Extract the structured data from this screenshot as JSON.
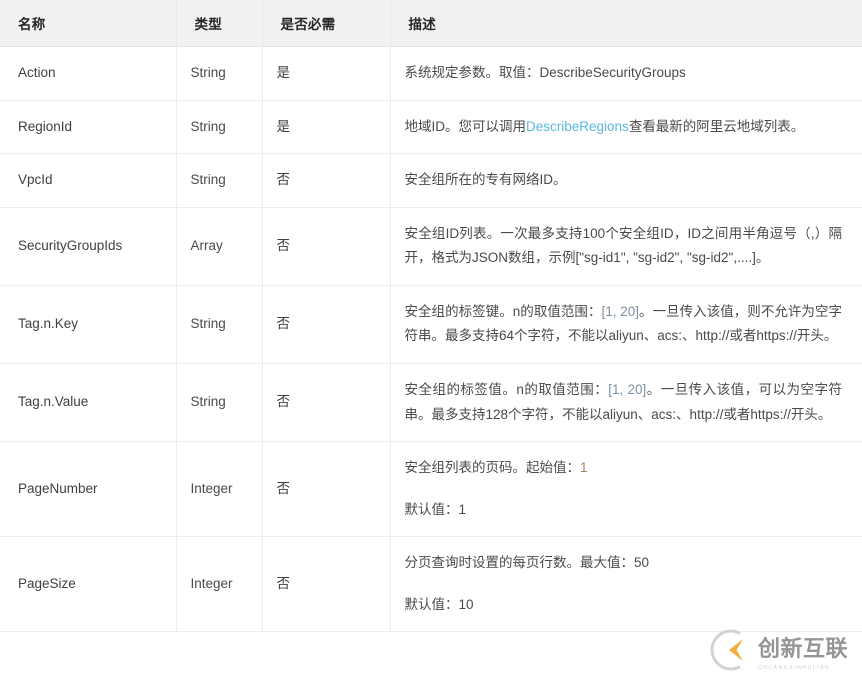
{
  "table": {
    "columns": [
      {
        "key": "name",
        "label": "名称"
      },
      {
        "key": "type",
        "label": "类型"
      },
      {
        "key": "required",
        "label": "是否必需"
      },
      {
        "key": "description",
        "label": "描述"
      }
    ],
    "rows": [
      {
        "name": "Action",
        "type": "String",
        "required": "是",
        "description_lines": [
          "系统规定参数。取值：DescribeSecurityGroups"
        ],
        "description_plain": "系统规定参数。取值：DescribeSecurityGroups"
      },
      {
        "name": "RegionId",
        "type": "String",
        "required": "是",
        "description_lines": [
          "地域ID。您可以调用DescribeRegions查看最新的阿里云地域列表。"
        ],
        "description_plain": "地域ID。您可以调用DescribeRegions查看最新的阿里云地域列表。",
        "description_link": {
          "text": "DescribeRegions",
          "before": "地域ID。您可以调用",
          "after": "查看最新的阿里云地域列表。"
        }
      },
      {
        "name": "VpcId",
        "type": "String",
        "required": "否",
        "description_lines": [
          "安全组所在的专有网络ID。"
        ],
        "description_plain": "安全组所在的专有网络ID。"
      },
      {
        "name": "SecurityGroupIds",
        "type": "Array",
        "required": "否",
        "description_lines": [
          "安全组ID列表。一次最多支持100个安全组ID，ID之间用半角逗号（,）隔开，格式为JSON数组，示例[\"sg-id1\", \"sg-id2\", \"sg-id2\",....]。"
        ],
        "description_plain": "安全组ID列表。一次最多支持100个安全组ID，ID之间用半角逗号（,）隔开，格式为JSON数组，示例[\"sg-id1\", \"sg-id2\", \"sg-id2\",....]。"
      },
      {
        "name": "Tag.n.Key",
        "type": "String",
        "required": "否",
        "description_lines": [
          "安全组的标签键。n的取值范围：[1, 20]。一旦传入该值，则不允许为空字符串。最多支持64个字符，不能以aliyun、acs:、http://或者https://开头。"
        ],
        "description_plain": "安全组的标签键。n的取值范围：[1, 20]。一旦传入该值，则不允许为空字符串。最多支持64个字符，不能以aliyun、acs:、http://或者https://开头。",
        "description_parts": {
          "before": "安全组的标签键。n的取值范围：",
          "range": "[1, 20]",
          "after": "。一旦传入该值，则不允许为空字符串。最多支持64个字符，不能以aliyun、acs:、http://或者https://开头。"
        }
      },
      {
        "name": "Tag.n.Value",
        "type": "String",
        "required": "否",
        "description_lines": [
          "安全组的标签值。n的取值范围：[1, 20]。一旦传入该值，可以为空字符串。最多支持128个字符，不能以aliyun、acs:、http://或者https://开头。"
        ],
        "description_plain": "安全组的标签值。n的取值范围：[1, 20]。一旦传入该值，可以为空字符串。最多支持128个字符，不能以aliyun、acs:、http://或者https://开头。",
        "description_parts": {
          "before": "安全组的标签值。n的取值范围：",
          "range": "[1, 20]",
          "after": "。一旦传入该值，可以为空字符串。最多支持128个字符，不能以aliyun、acs:、http://或者https://开头。"
        }
      },
      {
        "name": "PageNumber",
        "type": "Integer",
        "required": "否",
        "description_lines": [
          "安全组列表的页码。起始值：1",
          "默认值：1"
        ],
        "description_plain": "安全组列表的页码。起始值：1 默认值：1",
        "description_parts": {
          "line1_before": "安全组列表的页码。起始值：",
          "line1_value": "1",
          "line2_before": "默认值：",
          "line2_value": "1"
        }
      },
      {
        "name": "PageSize",
        "type": "Integer",
        "required": "否",
        "description_lines": [
          "分页查询时设置的每页行数。最大值：50",
          "默认值：10"
        ],
        "description_plain": "分页查询时设置的每页行数。最大值：50 默认值：10",
        "description_parts": {
          "line1_before": "分页查询时设置的每页行数。最大值：",
          "line1_value": "50",
          "line2_before": "默认值：",
          "line2_value": "10"
        }
      }
    ]
  },
  "watermark": {
    "text": "创新互联",
    "subtext": "CHUANGXINHULIAN",
    "logo_icon": "c-chevron-logo-icon",
    "colors": {
      "accent": "#f0a92a",
      "text": "#8d8d8d"
    }
  },
  "colors": {
    "link": "#59b8e0",
    "header_bg": "#f1f1f1",
    "border": "#ececec",
    "text": "#4a4a4a"
  }
}
